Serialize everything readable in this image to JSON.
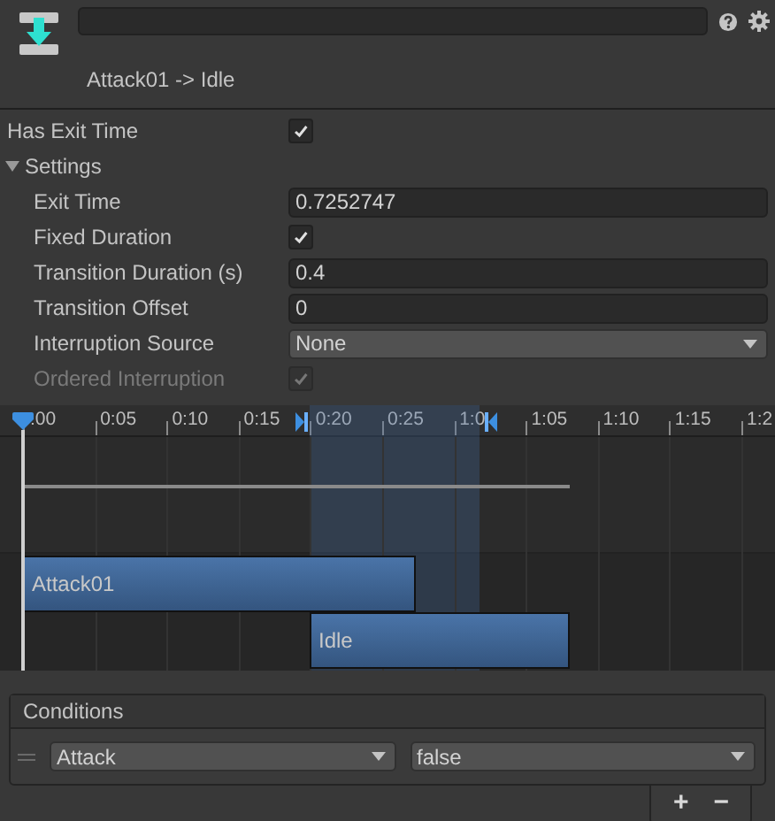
{
  "header": {
    "title": "Attack01 -> Idle"
  },
  "has_exit_time": {
    "label": "Has Exit Time",
    "checked": true
  },
  "settings": {
    "label": "Settings",
    "expanded": true,
    "items": [
      {
        "kind": "text",
        "label": "Exit Time",
        "value": "0.7252747"
      },
      {
        "kind": "checkbox",
        "label": "Fixed Duration",
        "checked": true,
        "disabled": false
      },
      {
        "kind": "text",
        "label": "Transition Duration (s)",
        "value": "0.4"
      },
      {
        "kind": "text",
        "label": "Transition Offset",
        "value": "0"
      },
      {
        "kind": "dropdown",
        "label": "Interruption Source",
        "value": "None"
      },
      {
        "kind": "checkbox",
        "label": "Ordered Interruption",
        "checked": true,
        "disabled": true
      }
    ]
  },
  "timeline": {
    "ruler": [
      ":00",
      "0:05",
      "0:10",
      "0:15",
      "0:20",
      "0:25",
      "1:0",
      "1:05",
      "1:10",
      "1:15",
      "1:2"
    ],
    "clips": [
      {
        "label": "Attack01"
      },
      {
        "label": "Idle"
      }
    ]
  },
  "conditions": {
    "title": "Conditions",
    "rows": [
      {
        "parameter": "Attack",
        "value": "false"
      }
    ],
    "buttons": [
      "+",
      "−"
    ]
  }
}
